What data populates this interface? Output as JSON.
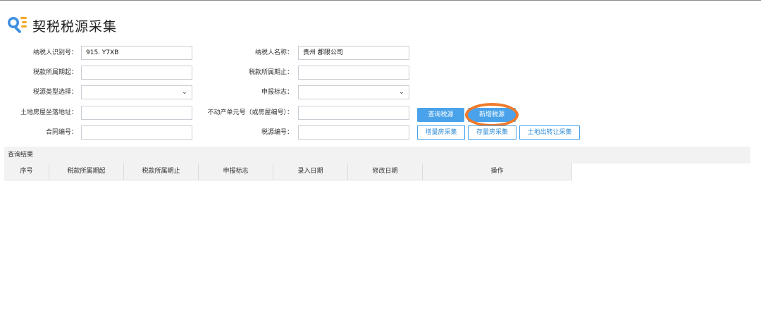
{
  "page": {
    "title": "契税税源采集"
  },
  "form": {
    "taxpayer_id": {
      "label": "纳税人识别号：",
      "value": "915.                     Y7XB"
    },
    "taxpayer_name": {
      "label": "纳税人名称：",
      "value": "贵州                  郡限公司"
    },
    "period_start": {
      "label": "税款所属期起：",
      "value": ""
    },
    "period_end": {
      "label": "税款所属期止：",
      "value": ""
    },
    "source_type": {
      "label": "税源类型选择：",
      "value": ""
    },
    "declare_flag": {
      "label": "申报标志：",
      "value": ""
    },
    "land_address": {
      "label": "土地房屋坐落地址：",
      "value": ""
    },
    "property_unit_no": {
      "label": "不动产单元号（或房屋编号）：",
      "value": ""
    },
    "contract_no": {
      "label": "合同编号：",
      "value": ""
    },
    "source_no": {
      "label": "税源编号：",
      "value": ""
    }
  },
  "buttons": {
    "query": "查询税源",
    "add_new": "新增税源",
    "incremental_house": "增量房采集",
    "stock_house": "存量房采集",
    "land_transfer": "土地出转让采集"
  },
  "results": {
    "title": "查询结果",
    "columns": [
      "序号",
      "税款所属期起",
      "税款所属期止",
      "申报标志",
      "录入日期",
      "修改日期",
      "操作"
    ]
  },
  "icons": {
    "title_icon": "search-list-icon",
    "select_chevron": "chevron-down-icon"
  },
  "colors": {
    "primary_button": "#4aa3ea",
    "highlight_ring": "#f07a2a",
    "title_icon_blue": "#3d8fe0",
    "title_icon_orange": "#f5a623"
  }
}
